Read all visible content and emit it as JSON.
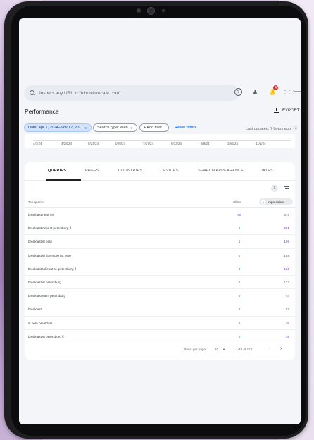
{
  "header": {
    "search_placeholder": "Inspect any URL in \"tchotchkecafe.com\"",
    "notification_count": "4"
  },
  "page": {
    "title": "Performance",
    "export_label": "EXPORT"
  },
  "filters": {
    "date": "Date: Apr 1, 2024–Nov 17, 20...",
    "search_type": "Search type: Web",
    "add_filter": "+ Add filter",
    "reset": "Reset filters",
    "last_updated": "Last updated: 7 hours ago"
  },
  "mini_axis": {
    "ticks": [
      "4/1/24",
      "4/28/24",
      "5/24/24",
      "6/20/24",
      "7/17/24",
      "8/13/24",
      "9/9/24",
      "10/5/24",
      "11/1/24"
    ]
  },
  "tabs": [
    "QUERIES",
    "PAGES",
    "COUNTRIES",
    "DEVICES",
    "SEARCH APPEARANCE",
    "DATES"
  ],
  "table": {
    "filter_count": "1",
    "col_query": "Top queries",
    "col_clicks": "Clicks",
    "col_impressions": "Impressions",
    "rows": [
      {
        "query": "breakfast near me",
        "clicks": "68",
        "impressions": "376"
      },
      {
        "query": "breakfast near st petersburg fl",
        "clicks": "0",
        "impressions": "281"
      },
      {
        "query": "breakfast st pete",
        "clicks": "1",
        "impressions": "196"
      },
      {
        "query": "breakfast in downtown st pete",
        "clicks": "0",
        "impressions": "158"
      },
      {
        "query": "breakfast takeout st. petersburg fl",
        "clicks": "0",
        "impressions": "132"
      },
      {
        "query": "breakfast st petersburg",
        "clicks": "0",
        "impressions": "123"
      },
      {
        "query": "breakfast saint petersburg",
        "clicks": "0",
        "impressions": "44"
      },
      {
        "query": "breakfast",
        "clicks": "5",
        "impressions": "57"
      },
      {
        "query": "st pete breakfast",
        "clicks": "0",
        "impressions": "36"
      },
      {
        "query": "breakfast st petersburg fl",
        "clicks": "0",
        "impressions": "35"
      }
    ]
  },
  "pager": {
    "rows_per_page_label": "Rows per page:",
    "rows_per_page_value": "10",
    "range": "1-10 of 113"
  }
}
